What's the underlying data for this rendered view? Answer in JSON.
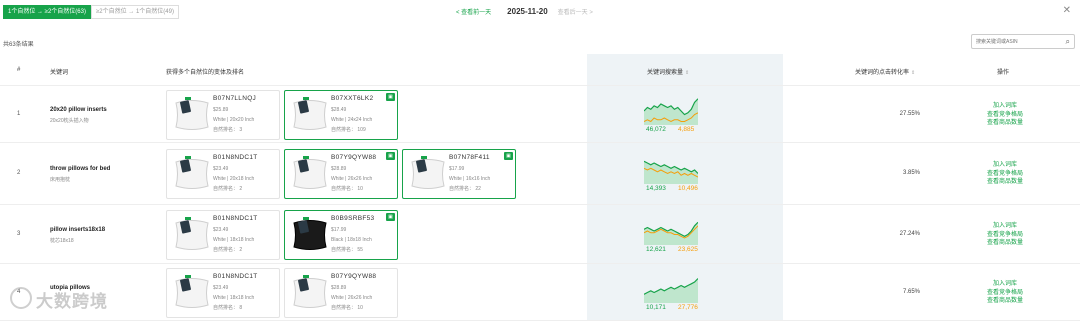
{
  "tabs": [
    {
      "label": "1个自然位 → ≥2个自然位(63)",
      "active": true
    },
    {
      "label": "≥2个自然位 → 1个自然位(49)",
      "active": false
    }
  ],
  "date_nav": {
    "prev": "< 查看前一天",
    "date": "2025-11-20",
    "next": "查看后一天 >"
  },
  "result_count": "共63条结果",
  "search": {
    "placeholder": "搜索关键词或ASIN"
  },
  "headers": {
    "num": "#",
    "keyword": "关键词",
    "products": "获得多个自然位的变体及排名",
    "search_volume": "关键词搜索量",
    "conversion": "关键词的点击转化率",
    "actions": "操作"
  },
  "rows": [
    {
      "num": "1",
      "keyword": "20x20 pillow inserts",
      "translation": "20x20枕头插入物",
      "products": [
        {
          "asin": "B07N7LLNQJ",
          "price": "$25.89",
          "variant": "White | 20x20 Inch",
          "rank": "自然排名： 3",
          "selected": false,
          "dark": false
        },
        {
          "asin": "B07XXT6LK2",
          "price": "$28.49",
          "variant": "White | 24x24 Inch",
          "rank": "自然排名： 109",
          "selected": true,
          "dark": false
        }
      ],
      "sv_green": "46,072",
      "sv_orange": "4,885",
      "trend": [
        8,
        10,
        9,
        11,
        10,
        12,
        11,
        10,
        11,
        9,
        10,
        8,
        6,
        7,
        9,
        13,
        15
      ],
      "trend2": [
        2,
        3,
        2,
        4,
        3,
        3,
        4,
        3,
        2,
        3,
        3,
        2,
        2,
        3,
        4,
        6,
        7
      ],
      "conversion": "27.55%",
      "actions": [
        "加入词库",
        "查看竞争格局",
        "查看商品数量"
      ]
    },
    {
      "num": "2",
      "keyword": "throw pillows for bed",
      "translation": "床用抱枕",
      "products": [
        {
          "asin": "B01N8NDC1T",
          "price": "$23.49",
          "variant": "White | 20x18 Inch",
          "rank": "自然排名： 2",
          "selected": false,
          "dark": false
        },
        {
          "asin": "B07Y9QYW88",
          "price": "$28.89",
          "variant": "White | 26x26 Inch",
          "rank": "自然排名： 10",
          "selected": true,
          "dark": false
        },
        {
          "asin": "B07N78F411",
          "price": "$17.99",
          "variant": "White | 16x16 Inch",
          "rank": "自然排名： 22",
          "selected": true,
          "dark": false
        }
      ],
      "sv_green": "14,393",
      "sv_orange": "10,496",
      "trend": [
        13,
        12,
        11,
        12,
        11,
        10,
        11,
        10,
        9,
        10,
        9,
        8,
        9,
        8,
        7,
        8,
        6
      ],
      "trend2": [
        9,
        8,
        9,
        8,
        7,
        8,
        7,
        6,
        7,
        6,
        7,
        5,
        6,
        5,
        6,
        5,
        4
      ],
      "conversion": "3.85%",
      "actions": [
        "加入词库",
        "查看竞争格局",
        "查看商品数量"
      ]
    },
    {
      "num": "3",
      "keyword": "pillow inserts18x18",
      "translation": "枕芯18x18",
      "products": [
        {
          "asin": "B01N8NDC1T",
          "price": "$23.49",
          "variant": "White | 18x18 Inch",
          "rank": "自然排名： 2",
          "selected": false,
          "dark": false
        },
        {
          "asin": "B0B9SRBF53",
          "price": "$17.99",
          "variant": "Black | 18x18 Inch",
          "rank": "自然排名： 55",
          "selected": true,
          "dark": true
        }
      ],
      "sv_green": "12,621",
      "sv_orange": "23,625",
      "trend": [
        9,
        10,
        9,
        8,
        9,
        10,
        9,
        8,
        9,
        8,
        7,
        6,
        5,
        6,
        8,
        11,
        13
      ],
      "trend2": [
        7,
        8,
        7,
        7,
        8,
        9,
        8,
        7,
        7,
        6,
        6,
        5,
        4,
        5,
        7,
        9,
        11
      ],
      "conversion": "27.24%",
      "actions": [
        "加入词库",
        "查看竞争格局",
        "查看商品数量"
      ]
    },
    {
      "num": "4",
      "keyword": "utopia pillows",
      "translation": "",
      "products": [
        {
          "asin": "B01N8NDC1T",
          "price": "$23.49",
          "variant": "White | 18x18 Inch",
          "rank": "自然排名： 8",
          "selected": false,
          "dark": false
        },
        {
          "asin": "B07Y9QYW88",
          "price": "$28.89",
          "variant": "White | 26x26 Inch",
          "rank": "自然排名： 10",
          "selected": false,
          "dark": false
        }
      ],
      "sv_green": "10,171",
      "sv_orange": "27,776",
      "trend": [
        5,
        6,
        7,
        6,
        7,
        8,
        7,
        8,
        9,
        8,
        9,
        10,
        9,
        10,
        11,
        12,
        14
      ],
      "trend2": [],
      "conversion": "7.65%",
      "actions": [
        "加入词库",
        "查看竞争格局",
        "查看商品数量"
      ]
    }
  ],
  "watermark": "大数跨境",
  "colors": {
    "accent": "#17a34a",
    "orange": "#f59e0b",
    "highlight_col": "#eef3f6"
  }
}
